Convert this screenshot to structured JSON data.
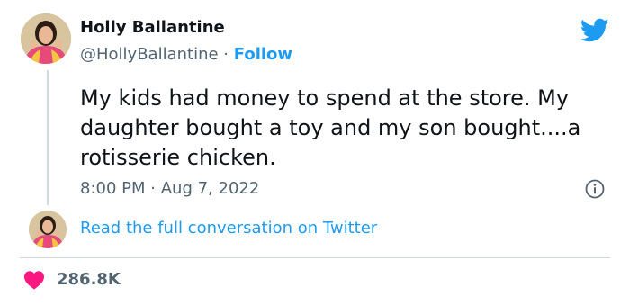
{
  "tweet": {
    "author_name": "Holly Ballantine",
    "handle": "@HollyBallantine",
    "separator": "·",
    "follow_label": "Follow",
    "text": "My kids had money to spend at the store. My daughter bought a toy and my son bought....a rotisserie chicken.",
    "time": "8:00 PM",
    "date": "Aug 7, 2022",
    "read_more_label": "Read the full conversation on Twitter",
    "likes": "286.8K"
  },
  "icons": {
    "brand": "twitter-bird-icon",
    "info": "info-icon",
    "like": "heart-icon"
  },
  "colors": {
    "accent": "#1d9bf0",
    "heart": "#f91880",
    "secondary_text": "#536471"
  }
}
